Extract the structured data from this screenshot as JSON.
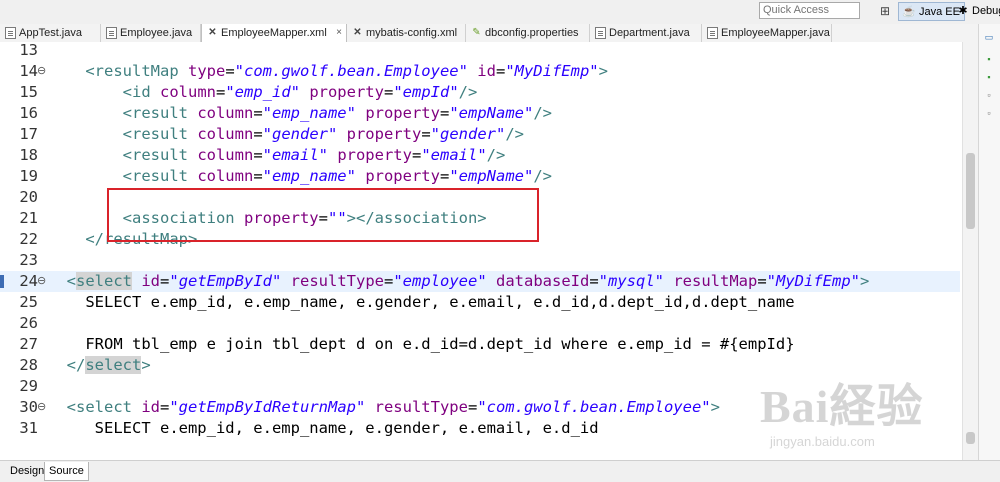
{
  "toolbar": {
    "quick_access_placeholder": "Quick Access",
    "perspectives": [
      "Java EE",
      "Debug"
    ]
  },
  "tabs": [
    {
      "label": "AppTest.java",
      "icon": "java-file-icon"
    },
    {
      "label": "Employee.java",
      "icon": "java-file-icon"
    },
    {
      "label": "EmployeeMapper.xml",
      "icon": "xml-file-icon",
      "active": true
    },
    {
      "label": "mybatis-config.xml",
      "icon": "xml-file-icon"
    },
    {
      "label": "dbconfig.properties",
      "icon": "properties-file-icon"
    },
    {
      "label": "Department.java",
      "icon": "java-file-icon"
    },
    {
      "label": "EmployeeMapper.java",
      "icon": "java-file-icon"
    }
  ],
  "tab_close": "×",
  "editor": {
    "lines": [
      {
        "n": "13",
        "tokens": []
      },
      {
        "n": "14",
        "marker": "⊖",
        "tokens": [
          {
            "t": "    ",
            "c": "plain"
          },
          {
            "t": "<resultMap",
            "c": "tag"
          },
          {
            "t": " type",
            "c": "attr"
          },
          {
            "t": "=",
            "c": "plain"
          },
          {
            "t": "\"com.gwolf.bean.Employee\"",
            "c": "val"
          },
          {
            "t": " id",
            "c": "attr"
          },
          {
            "t": "=",
            "c": "plain"
          },
          {
            "t": "\"MyDifEmp\"",
            "c": "val"
          },
          {
            "t": ">",
            "c": "tag"
          }
        ]
      },
      {
        "n": "15",
        "tokens": [
          {
            "t": "        ",
            "c": "plain"
          },
          {
            "t": "<id",
            "c": "tag"
          },
          {
            "t": " column",
            "c": "attr"
          },
          {
            "t": "=",
            "c": "plain"
          },
          {
            "t": "\"emp_id\"",
            "c": "val"
          },
          {
            "t": " property",
            "c": "attr"
          },
          {
            "t": "=",
            "c": "plain"
          },
          {
            "t": "\"empId\"",
            "c": "val"
          },
          {
            "t": "/>",
            "c": "tag"
          }
        ]
      },
      {
        "n": "16",
        "tokens": [
          {
            "t": "        ",
            "c": "plain"
          },
          {
            "t": "<result",
            "c": "tag"
          },
          {
            "t": " column",
            "c": "attr"
          },
          {
            "t": "=",
            "c": "plain"
          },
          {
            "t": "\"emp_name\"",
            "c": "val"
          },
          {
            "t": " property",
            "c": "attr"
          },
          {
            "t": "=",
            "c": "plain"
          },
          {
            "t": "\"empName\"",
            "c": "val"
          },
          {
            "t": "/>",
            "c": "tag"
          }
        ]
      },
      {
        "n": "17",
        "tokens": [
          {
            "t": "        ",
            "c": "plain"
          },
          {
            "t": "<result",
            "c": "tag"
          },
          {
            "t": " column",
            "c": "attr"
          },
          {
            "t": "=",
            "c": "plain"
          },
          {
            "t": "\"gender\"",
            "c": "val"
          },
          {
            "t": " property",
            "c": "attr"
          },
          {
            "t": "=",
            "c": "plain"
          },
          {
            "t": "\"gender\"",
            "c": "val"
          },
          {
            "t": "/>",
            "c": "tag"
          }
        ]
      },
      {
        "n": "18",
        "tokens": [
          {
            "t": "        ",
            "c": "plain"
          },
          {
            "t": "<result",
            "c": "tag"
          },
          {
            "t": " column",
            "c": "attr"
          },
          {
            "t": "=",
            "c": "plain"
          },
          {
            "t": "\"email\"",
            "c": "val"
          },
          {
            "t": " property",
            "c": "attr"
          },
          {
            "t": "=",
            "c": "plain"
          },
          {
            "t": "\"email\"",
            "c": "val"
          },
          {
            "t": "/>",
            "c": "tag"
          }
        ]
      },
      {
        "n": "19",
        "tokens": [
          {
            "t": "        ",
            "c": "plain"
          },
          {
            "t": "<result",
            "c": "tag"
          },
          {
            "t": " column",
            "c": "attr"
          },
          {
            "t": "=",
            "c": "plain"
          },
          {
            "t": "\"emp_name\"",
            "c": "val"
          },
          {
            "t": " property",
            "c": "attr"
          },
          {
            "t": "=",
            "c": "plain"
          },
          {
            "t": "\"empName\"",
            "c": "val"
          },
          {
            "t": "/>",
            "c": "tag"
          }
        ]
      },
      {
        "n": "20",
        "tokens": []
      },
      {
        "n": "21",
        "tokens": [
          {
            "t": "        ",
            "c": "plain"
          },
          {
            "t": "<association",
            "c": "tag"
          },
          {
            "t": " property",
            "c": "attr"
          },
          {
            "t": "=",
            "c": "plain"
          },
          {
            "t": "\"\"",
            "c": "val"
          },
          {
            "t": "></association>",
            "c": "tag"
          }
        ]
      },
      {
        "n": "22",
        "tokens": [
          {
            "t": "    ",
            "c": "plain"
          },
          {
            "t": "</resultMap>",
            "c": "tag"
          }
        ]
      },
      {
        "n": "23",
        "tokens": []
      },
      {
        "n": "24",
        "marker": "⊖",
        "current": true,
        "tokens": [
          {
            "t": "  ",
            "c": "plain"
          },
          {
            "t": "<",
            "c": "tag"
          },
          {
            "t": "select",
            "c": "selkw"
          },
          {
            "t": " id",
            "c": "attr"
          },
          {
            "t": "=",
            "c": "plain"
          },
          {
            "t": "\"getEmpById\"",
            "c": "val"
          },
          {
            "t": " resultType",
            "c": "attr"
          },
          {
            "t": "=",
            "c": "plain"
          },
          {
            "t": "\"employee\"",
            "c": "val"
          },
          {
            "t": " databaseId",
            "c": "attr"
          },
          {
            "t": "=",
            "c": "plain"
          },
          {
            "t": "\"mysql\"",
            "c": "val"
          },
          {
            "t": " resultMap",
            "c": "attr"
          },
          {
            "t": "=",
            "c": "plain"
          },
          {
            "t": "\"MyDifEmp\"",
            "c": "val"
          },
          {
            "t": ">",
            "c": "tag"
          }
        ]
      },
      {
        "n": "25",
        "tokens": [
          {
            "t": "    SELECT e.emp_id, e.emp_name, e.gender, e.email, e.d_id,d.dept_id,d.dept_name",
            "c": "plain"
          }
        ]
      },
      {
        "n": "26",
        "tokens": []
      },
      {
        "n": "27",
        "tokens": [
          {
            "t": "    FROM tbl_emp e join tbl_dept d on e.d_id=d.dept_id where e.emp_id = #{empId}",
            "c": "plain"
          }
        ]
      },
      {
        "n": "28",
        "tokens": [
          {
            "t": "  ",
            "c": "plain"
          },
          {
            "t": "</",
            "c": "tag"
          },
          {
            "t": "select",
            "c": "selkw"
          },
          {
            "t": ">",
            "c": "tag"
          }
        ]
      },
      {
        "n": "29",
        "tokens": []
      },
      {
        "n": "30",
        "marker": "⊖",
        "tokens": [
          {
            "t": "  ",
            "c": "plain"
          },
          {
            "t": "<select",
            "c": "tag"
          },
          {
            "t": " id",
            "c": "attr"
          },
          {
            "t": "=",
            "c": "plain"
          },
          {
            "t": "\"getEmpByIdReturnMap\"",
            "c": "val"
          },
          {
            "t": " resultType",
            "c": "attr"
          },
          {
            "t": "=",
            "c": "plain"
          },
          {
            "t": "\"com.gwolf.bean.Employee\"",
            "c": "val"
          },
          {
            "t": ">",
            "c": "tag"
          }
        ]
      },
      {
        "n": "31",
        "tokens": [
          {
            "t": "     SELECT e.emp_id, e.emp_name, e.gender, e.email, e.d_id",
            "c": "plain"
          }
        ]
      }
    ]
  },
  "bottom_tabs": [
    "Design",
    "Source"
  ],
  "active_bottom_tab": "Source",
  "watermark": {
    "logo": "Bai経验",
    "url": "jingyan.baidu.com"
  },
  "colors": {
    "highlight_box": "#d9232a",
    "tag": "#3f7f7f",
    "attribute": "#7f007f",
    "value": "#2a00ff",
    "current_line": "#e8f2fe"
  }
}
